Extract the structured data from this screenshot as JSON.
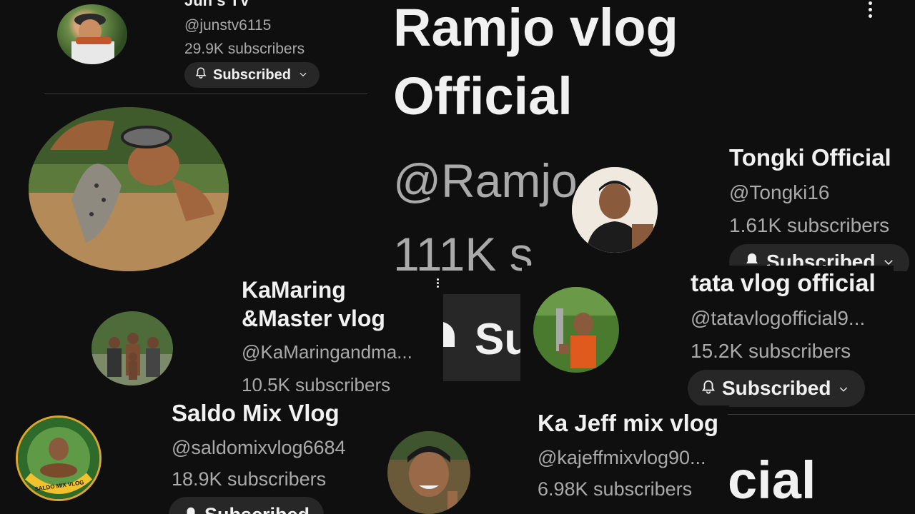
{
  "channels": [
    {
      "name": "Junʼs TV",
      "handle": "@junstv6115",
      "subscribers": "29.9K subscribers",
      "button": "Subscribed"
    },
    {
      "name": "Ramjo vlog Official",
      "name_line1": "Ramjo vlog",
      "name_line2": "Official",
      "handle": "@Ramjo",
      "subscribers": "111K s",
      "button": "Su"
    },
    {
      "name": "Tongki Official",
      "handle": "@Tongki16",
      "subscribers": "1.61K subscribers",
      "button": "Subscribed"
    },
    {
      "name": "KaMaring &Master vlog",
      "name_line1": "KaMaring",
      "name_line2": "&Master vlog",
      "handle": "@KaMaringandma...",
      "subscribers": "10.5K subscribers"
    },
    {
      "name": "tata vlog official",
      "handle": "@tatavlogofficial9...",
      "subscribers": "15.2K subscribers",
      "button": "Subscribed"
    },
    {
      "name": "Saldo Mix Vlog",
      "handle": "@saldomixvlog6684",
      "subscribers": "18.9K subscribers",
      "button": "Subscribed",
      "avatar_badge": "SALDO MIX VLOG"
    },
    {
      "name": "Ka Jeff mix vlog",
      "handle": "@kajeffmixvlog90...",
      "subscribers": "6.98K subscribers"
    },
    {
      "name_fragment": "cial"
    }
  ],
  "icons": {
    "bell": "bell-icon",
    "chevron": "chevron-down-icon",
    "more": "more-vert-icon"
  },
  "colors": {
    "background": "#0f0f0f",
    "button_bg": "#272727",
    "primary_text": "#f1f1f1",
    "secondary_text": "#aaaaaa"
  }
}
